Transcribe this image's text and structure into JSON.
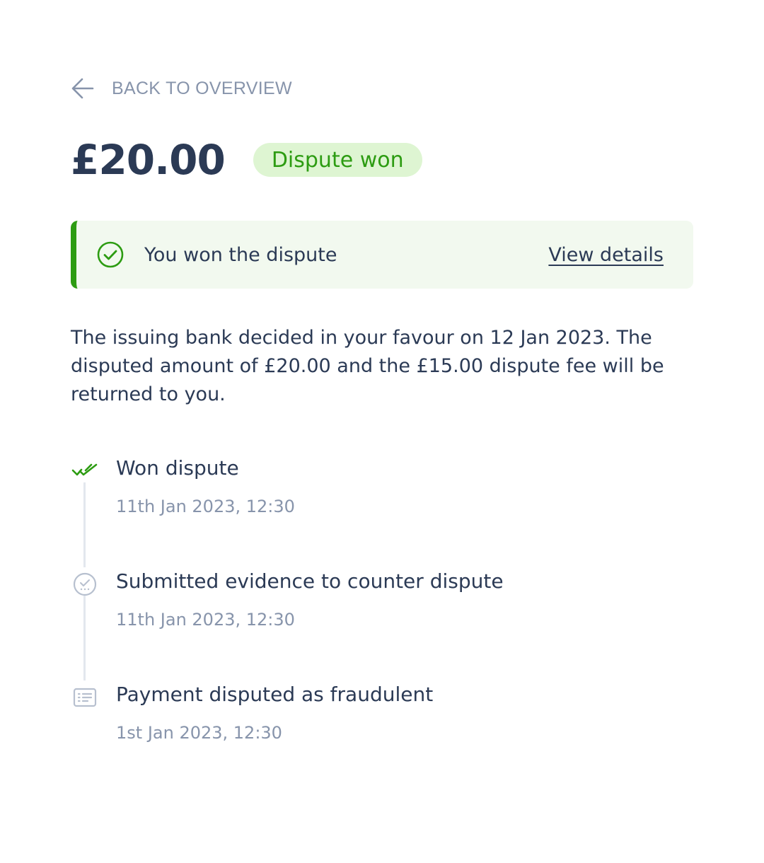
{
  "nav": {
    "back_label": "BACK TO OVERVIEW"
  },
  "header": {
    "amount": "£20.00",
    "status_badge": "Dispute won"
  },
  "alert": {
    "message": "You won the dispute",
    "link_label": "View details"
  },
  "description": "The issuing bank decided in your favour on 12 Jan 2023. The disputed amount of £20.00 and the £15.00 dispute fee will be returned to you.",
  "timeline": [
    {
      "title": "Won dispute",
      "time": "11th Jan 2023, 12:30",
      "icon": "double-check-icon"
    },
    {
      "title": "Submitted evidence to counter dispute",
      "time": "11th Jan 2023, 12:30",
      "icon": "pending-check-icon"
    },
    {
      "title": "Payment disputed as fraudulent",
      "time": "1st Jan 2023, 12:30",
      "icon": "list-icon"
    }
  ],
  "colors": {
    "text_primary": "#2b3a55",
    "text_muted": "#8794ab",
    "success": "#2d9c12",
    "success_bg": "#def5d2",
    "alert_bg": "#f2f9ef"
  }
}
